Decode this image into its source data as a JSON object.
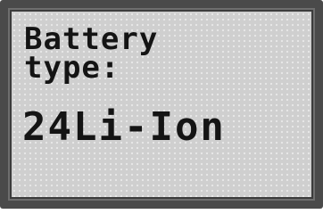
{
  "display": {
    "label_line1": "Battery",
    "label_line2": "type:",
    "value": "24Li-Ion"
  }
}
